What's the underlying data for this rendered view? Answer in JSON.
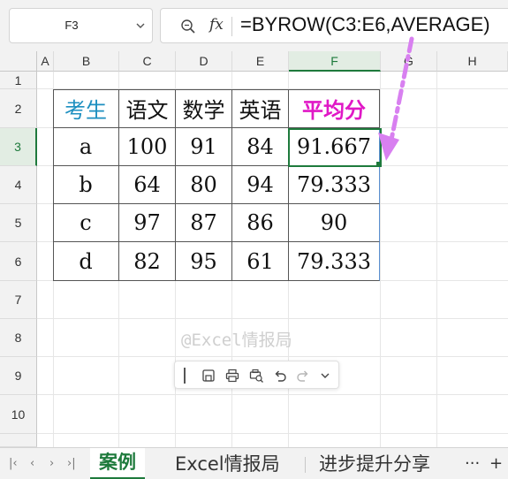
{
  "name_box": {
    "value": "F3"
  },
  "formula_bar": {
    "fx_label": "fx",
    "formula": "=BYROW(C3:E6,AVERAGE)"
  },
  "columns": [
    "A",
    "B",
    "C",
    "D",
    "E",
    "F",
    "G",
    "H"
  ],
  "selected_column": "F",
  "rows": [
    "1",
    "2",
    "3",
    "4",
    "5",
    "6",
    "7",
    "8",
    "9",
    "10"
  ],
  "selected_row": "3",
  "table": {
    "headers": [
      "考生",
      "语文",
      "数学",
      "英语",
      "平均分"
    ],
    "rows": [
      [
        "a",
        "100",
        "91",
        "84",
        "91.667"
      ],
      [
        "b",
        "64",
        "80",
        "94",
        "79.333"
      ],
      [
        "c",
        "97",
        "87",
        "86",
        "90"
      ],
      [
        "d",
        "82",
        "95",
        "61",
        "79.333"
      ]
    ]
  },
  "watermark": "@Excel情报局",
  "floating_toolbar": {
    "icons": [
      "grip-icon",
      "save-icon",
      "print-icon",
      "print-preview-icon",
      "undo-icon",
      "redo-icon",
      "chevron-down-icon"
    ]
  },
  "sheet_tabs": {
    "nav": [
      "|‹",
      "‹",
      "›",
      "›|"
    ],
    "tabs": [
      "案例",
      "Excel情报局",
      "进步提升分享"
    ],
    "active": "案例",
    "more": "···",
    "add": "+"
  },
  "colors": {
    "accent_green": "#1e7a3c",
    "header_blue": "#1d8fc0",
    "header_pink": "#e018c6",
    "arrow": "#d880f0"
  }
}
